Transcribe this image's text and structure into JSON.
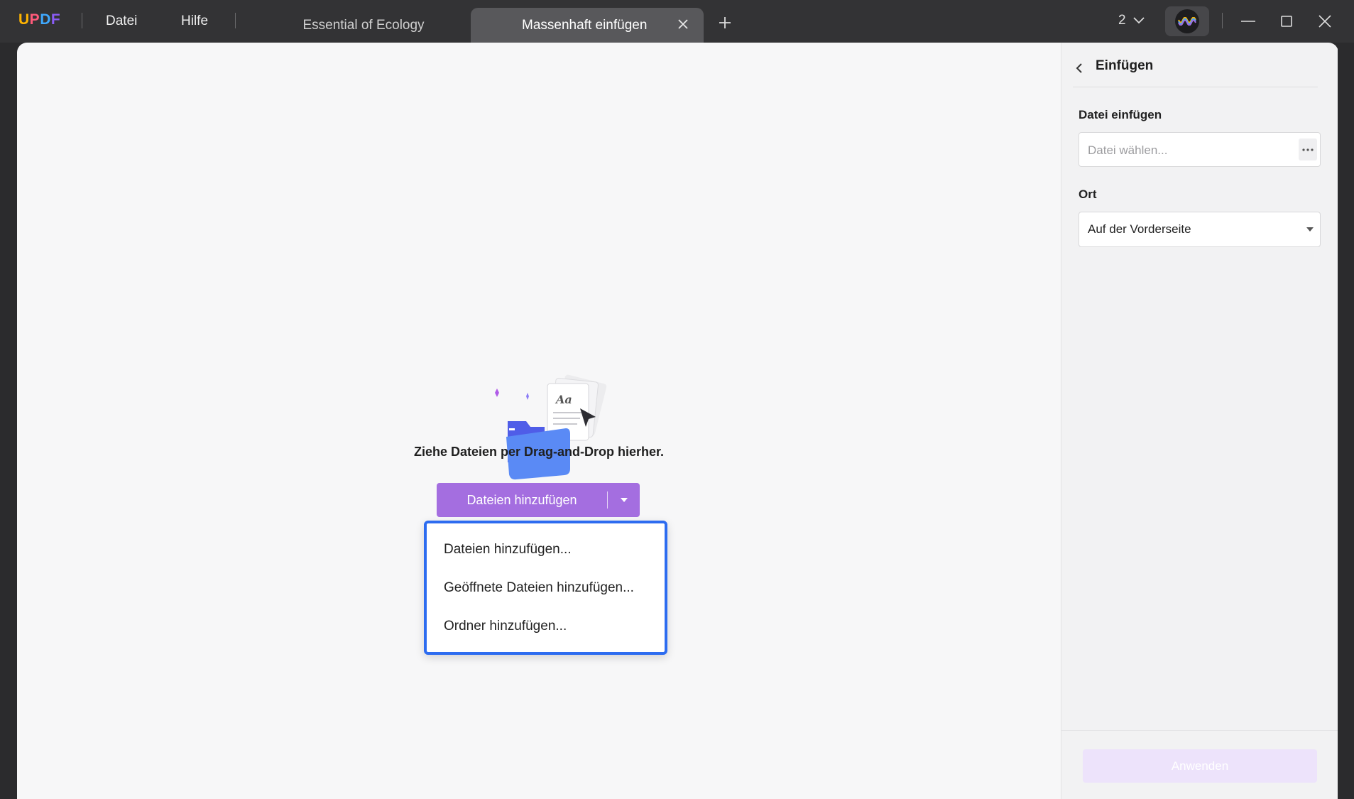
{
  "app": {
    "logo": "UPDF",
    "menu": {
      "file": "Datei",
      "help": "Hilfe"
    }
  },
  "tabs": [
    {
      "label": "Essential of Ecology",
      "active": false
    },
    {
      "label": "Massenhaft einfügen",
      "active": true
    }
  ],
  "titlebar": {
    "page_count": "2"
  },
  "main": {
    "drop_text": "Ziehe Dateien per Drag-and-Drop hierher.",
    "add_button_label": "Dateien hinzufügen",
    "dropdown_items": [
      "Dateien hinzufügen...",
      "Geöffnete Dateien hinzufügen...",
      "Ordner hinzufügen..."
    ]
  },
  "panel": {
    "title": "Einfügen",
    "file_label": "Datei einfügen",
    "file_placeholder": "Datei wählen...",
    "location_label": "Ort",
    "location_value": "Auf der Vorderseite",
    "apply_label": "Anwenden"
  },
  "colors": {
    "accent_purple": "#a46ee0",
    "dropdown_border": "#2d6cf0",
    "apply_disabled": "#ede3fb"
  },
  "icons": {
    "back": "chevron-left-icon",
    "close_tab": "close-icon",
    "new_tab": "plus-icon",
    "browse": "more-horizontal-icon",
    "select_arrow": "triangle-down-icon"
  }
}
